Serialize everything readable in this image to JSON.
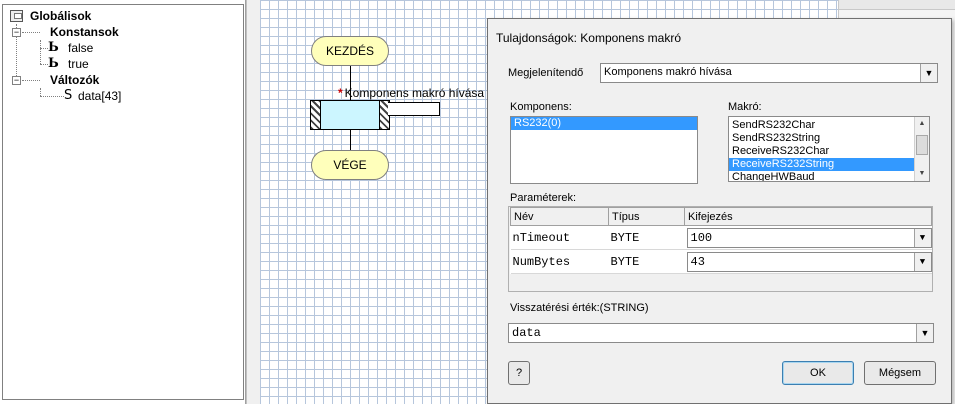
{
  "tree": {
    "root": "Globálisok",
    "constants": {
      "label": "Konstansok",
      "items": [
        "false",
        "true"
      ]
    },
    "variables": {
      "label": "Változók",
      "items": [
        "data[43]"
      ]
    },
    "icons": {
      "constant_glyph": "Ь",
      "string_glyph": "S"
    }
  },
  "flowchart": {
    "start": "KEZDÉS",
    "end": "VÉGE",
    "macro_star": "*",
    "macro_label": "Komponens makró hívása"
  },
  "dialog": {
    "title": "Tulajdonságok: Komponens makró",
    "display_label": "Megjelenítendő",
    "display_value": "Komponens makró hívása",
    "component_label": "Komponens:",
    "components": [
      {
        "name": "RS232(0)",
        "selected": true
      }
    ],
    "macro_label": "Makró:",
    "macros": [
      {
        "name": "SendRS232Char",
        "selected": false
      },
      {
        "name": "SendRS232String",
        "selected": false
      },
      {
        "name": "ReceiveRS232Char",
        "selected": false
      },
      {
        "name": "ReceiveRS232String",
        "selected": true
      },
      {
        "name": "ChangeHWBaud",
        "selected": false
      }
    ],
    "params_label": "Paraméterek:",
    "param_columns": [
      "Név",
      "Típus",
      "Kifejezés"
    ],
    "params": [
      {
        "name": "nTimeout",
        "type": "BYTE",
        "expr": "100"
      },
      {
        "name": "NumBytes",
        "type": "BYTE",
        "expr": "43"
      }
    ],
    "return_label": "Visszatérési érték:(STRING)",
    "return_value": "data",
    "help_label": "?",
    "ok_label": "OK",
    "cancel_label": "Mégsem"
  },
  "colors": {
    "terminal_fill": "#ffffbb",
    "macro_fill": "#ccf6ff",
    "selection": "#3399ff",
    "grid": "#b6c6dc"
  }
}
